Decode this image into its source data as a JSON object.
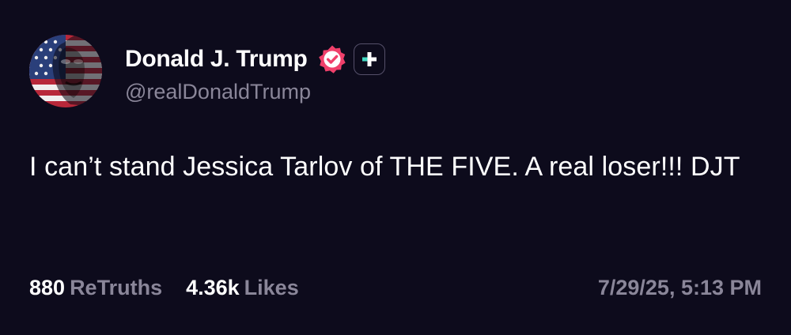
{
  "post": {
    "author": {
      "display_name": "Donald J. Trump",
      "handle": "@realDonaldTrump",
      "verified": true,
      "avatar_icon": "flag-portrait-avatar",
      "verified_icon": "verified-badge-icon",
      "plus_icon": "plus-badge-icon"
    },
    "text": "I can’t stand Jessica Tarlov of THE FIVE. A real loser!!! DJT",
    "stats": {
      "retruths_count": "880",
      "retruths_label": "ReTruths",
      "likes_count": "4.36k",
      "likes_label": "Likes"
    },
    "timestamp": "7/29/25, 5:13 PM"
  },
  "colors": {
    "background": "#0d0b1c",
    "primary_text": "#ffffff",
    "secondary_text": "#8a8699",
    "verified_badge": "#f0406b",
    "plus_accent": "#41d9c2"
  }
}
